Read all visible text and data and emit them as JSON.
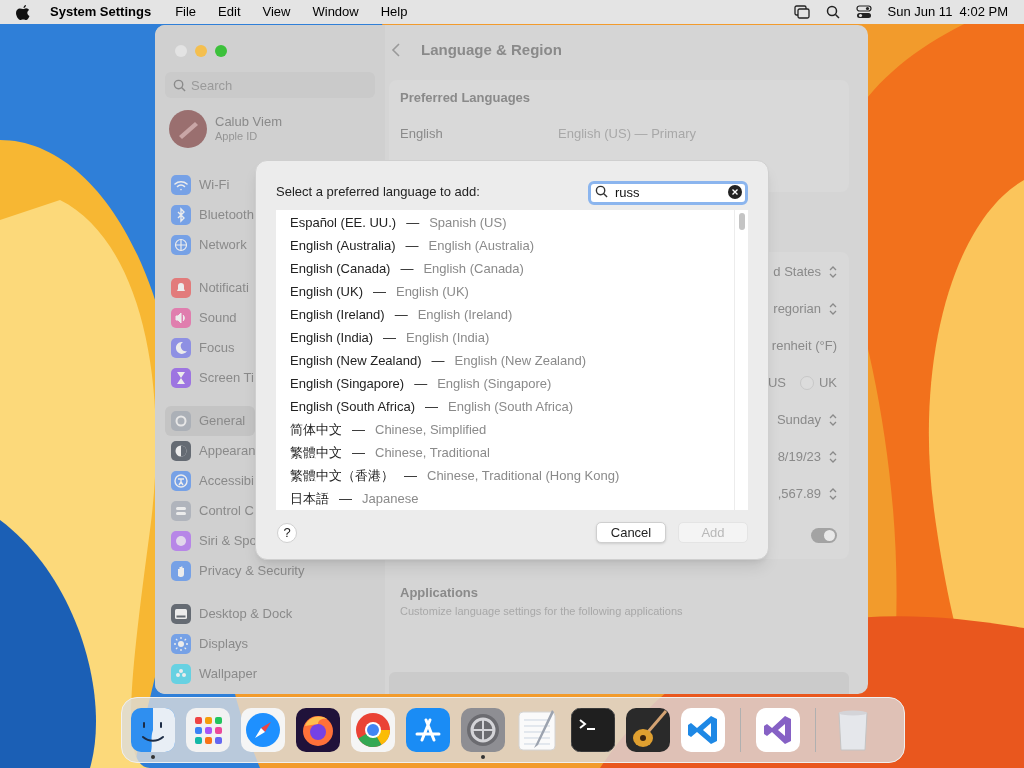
{
  "menu_bar": {
    "app": "System Settings",
    "menus": [
      "File",
      "Edit",
      "View",
      "Window",
      "Help"
    ],
    "clock": "Sun Jun 11  4:02 PM"
  },
  "window": {
    "title": "Language & Region",
    "sidebar": {
      "search_placeholder": "Search",
      "profile": {
        "name": "Calub Viem",
        "subtitle": "Apple ID"
      },
      "groups": [
        [
          {
            "label": "Wi-Fi",
            "selected": false
          },
          {
            "label": "Bluetooth",
            "selected": false
          },
          {
            "label": "Network",
            "selected": false
          }
        ],
        [
          {
            "label": "Notificati",
            "selected": false
          },
          {
            "label": "Sound",
            "selected": false
          },
          {
            "label": "Focus",
            "selected": false
          },
          {
            "label": "Screen Ti",
            "selected": false
          }
        ],
        [
          {
            "label": "General",
            "selected": true
          },
          {
            "label": "Appearan",
            "selected": false
          },
          {
            "label": "Accessibi",
            "selected": false
          },
          {
            "label": "Control C",
            "selected": false
          },
          {
            "label": "Siri & Spo",
            "selected": false
          },
          {
            "label": "Privacy & Security",
            "selected": false
          }
        ],
        [
          {
            "label": "Desktop & Dock",
            "selected": false
          },
          {
            "label": "Displays",
            "selected": false
          },
          {
            "label": "Wallpaper",
            "selected": false
          }
        ]
      ]
    },
    "preferred_languages": {
      "heading": "Preferred Languages",
      "rows": [
        {
          "language": "English",
          "detail": "English (US) — Primary"
        }
      ]
    },
    "region_rows": [
      {
        "kind": "popup",
        "value": "d States"
      },
      {
        "kind": "popup",
        "value": "regorian"
      },
      {
        "kind": "text",
        "value": "renheit (°F)"
      },
      {
        "kind": "radios",
        "options": [
          {
            "label": "US"
          },
          {
            "label": "UK",
            "selected": false
          }
        ]
      },
      {
        "kind": "popup",
        "value": "Sunday"
      },
      {
        "kind": "popup",
        "value": "8/19/23"
      },
      {
        "kind": "popup",
        "value": ",567.89"
      },
      {
        "kind": "toggle",
        "on": true
      }
    ],
    "applications": {
      "heading": "Applications",
      "description": "Customize language settings for the following applications"
    }
  },
  "dialog": {
    "prompt": "Select a preferred language to add:",
    "search": {
      "value": "russ"
    },
    "languages": [
      {
        "native": "Español (EE. UU.)",
        "english": "Spanish (US)"
      },
      {
        "native": "English (Australia)",
        "english": "English (Australia)"
      },
      {
        "native": "English (Canada)",
        "english": "English (Canada)"
      },
      {
        "native": "English (UK)",
        "english": "English (UK)"
      },
      {
        "native": "English (Ireland)",
        "english": "English (Ireland)"
      },
      {
        "native": "English (India)",
        "english": "English (India)"
      },
      {
        "native": "English (New Zealand)",
        "english": "English (New Zealand)"
      },
      {
        "native": "English (Singapore)",
        "english": "English (Singapore)"
      },
      {
        "native": "English (South Africa)",
        "english": "English (South Africa)"
      },
      {
        "native": "简体中文",
        "english": "Chinese, Simplified"
      },
      {
        "native": "繁體中文",
        "english": "Chinese, Traditional"
      },
      {
        "native": "繁體中文（香港）",
        "english": "Chinese, Traditional (Hong Kong)"
      },
      {
        "native": "日本語",
        "english": "Japanese"
      }
    ],
    "separator": "—",
    "help": "?",
    "buttons": [
      {
        "label": "Cancel",
        "disabled": false
      },
      {
        "label": "Add",
        "disabled": true
      }
    ]
  },
  "dock": [
    {
      "kind": "finder",
      "running": true
    },
    {
      "kind": "launchpad",
      "running": false
    },
    {
      "kind": "safari",
      "running": false
    },
    {
      "kind": "firefox",
      "running": false
    },
    {
      "kind": "chrome",
      "running": false
    },
    {
      "kind": "appstore",
      "running": false
    },
    {
      "kind": "settings",
      "running": true
    },
    {
      "kind": "textedit",
      "running": false
    },
    {
      "kind": "terminal",
      "running": false
    },
    {
      "kind": "garageband",
      "running": false
    },
    {
      "kind": "vscode",
      "running": false
    },
    {
      "kind": "divider"
    },
    {
      "kind": "visualstudio",
      "running": false
    },
    {
      "kind": "divider"
    },
    {
      "kind": "trash",
      "running": false
    }
  ]
}
